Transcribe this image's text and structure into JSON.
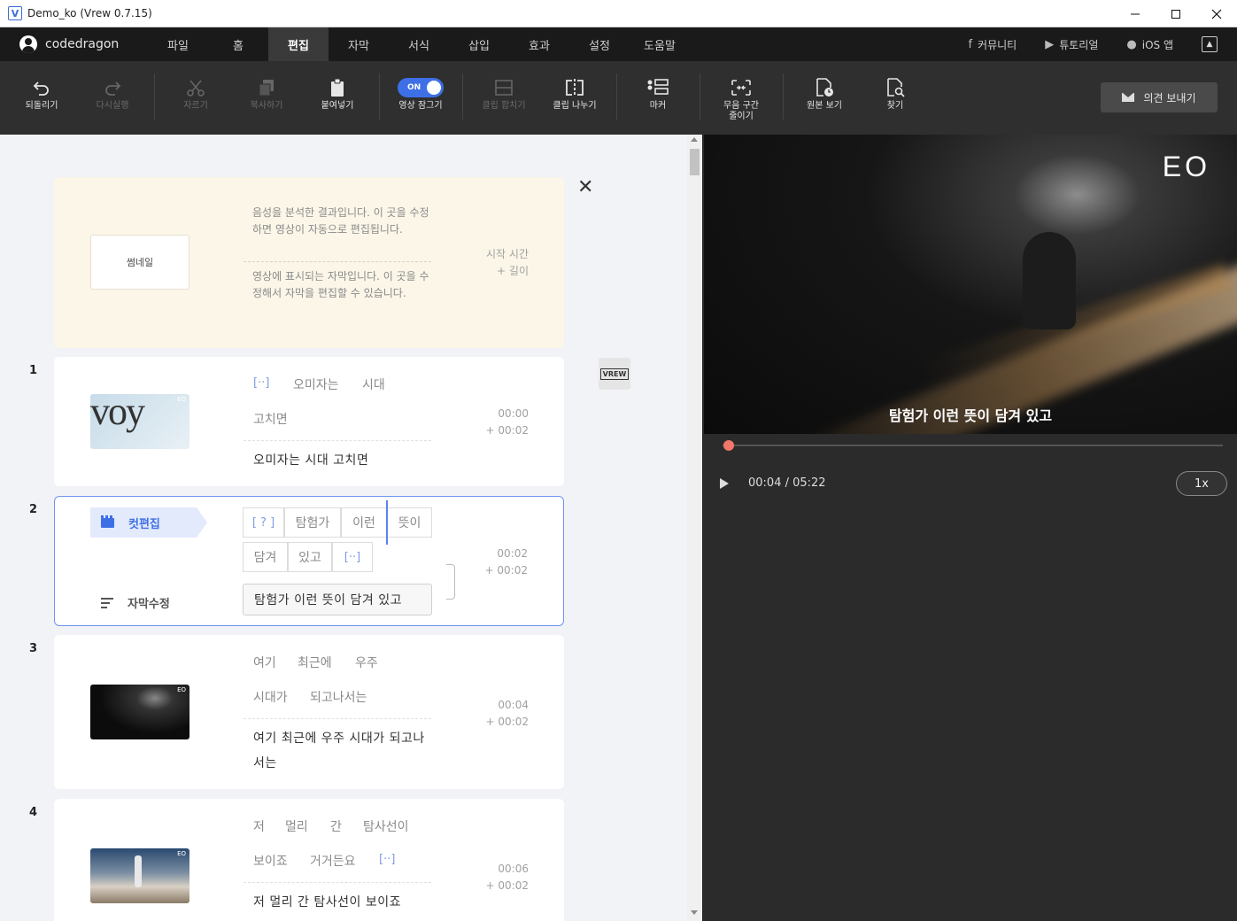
{
  "window": {
    "title": "Demo_ko (Vrew 0.7.15)",
    "icon_letter": "V",
    "controls": [
      "minimize-icon",
      "maximize-icon",
      "close-icon"
    ]
  },
  "menubar": {
    "user": "codedragon",
    "items": [
      "파일",
      "홈",
      "편집",
      "자막",
      "서식",
      "삽입",
      "효과",
      "설정",
      "도움말"
    ],
    "active": "편집",
    "links": [
      {
        "label": "커뮤니티",
        "icon": "facebook-icon"
      },
      {
        "label": "튜토리얼",
        "icon": "youtube-icon"
      },
      {
        "label": "iOS 앱",
        "icon": "apple-icon"
      }
    ]
  },
  "toolbar": {
    "undo": "되돌리기",
    "redo": "다시실행",
    "cut": "자르기",
    "copy": "복사하기",
    "paste": "붙여넣기",
    "toggle_on": "ON",
    "lock_video": "영상 잠그기",
    "merge_clip": "클립 합치기",
    "split_clip": "클립 나누기",
    "marker": "마커",
    "shrink_silence": "무음 구간\n줄이기",
    "view_original": "원본 보기",
    "find": "찾기",
    "feedback": "의견 보내기"
  },
  "guide": {
    "thumbnail": "썸네일",
    "text1": "음성을 분석한 결과입니다. 이 곳을 수정하면 영상이 자동으로 편집됩니다.",
    "text2": "영상에 표시되는 자막입니다. 이 곳을 수정해서 자막을 편집할 수 있습니다.",
    "time1": "시작 시간",
    "time2": "+ 길이"
  },
  "clips": [
    {
      "num": "1",
      "words_row1": [
        "[··]",
        "오미자는",
        "시대"
      ],
      "words_row2": [
        "고치면"
      ],
      "subtitle": "오미자는 시대 고치면",
      "start": "00:00",
      "length": "+ 00:02"
    },
    {
      "num": "2",
      "cut_edit": "컷편집",
      "sub_edit": "자막수정",
      "words_row1": [
        "[ ? ]",
        "탐험가",
        "이런",
        "뜻이"
      ],
      "words_row2": [
        "담겨",
        "있고",
        "[··]"
      ],
      "subtitle": "탐험가 이런 뜻이 담겨 있고",
      "start": "00:02",
      "length": "+ 00:02"
    },
    {
      "num": "3",
      "words_row1": [
        "여기",
        "최근에",
        "우주"
      ],
      "words_row2": [
        "시대가",
        "되고나서는"
      ],
      "subtitle": "여기 최근에 우주 시대가 되고나서는",
      "start": "00:04",
      "length": "+ 00:02"
    },
    {
      "num": "4",
      "words_row1": [
        "저",
        "멀리",
        "간",
        "탐사선이"
      ],
      "words_row2": [
        "보이죠",
        "거거든요",
        "[··]"
      ],
      "subtitle": "저 멀리 간 탐사선이 보이죠",
      "start": "00:06",
      "length": "+ 00:02"
    }
  ],
  "badge": "VREW",
  "thumb1_text": "voy",
  "thumb_logo": "EO",
  "preview": {
    "logo": "EO",
    "subtitle": "탐험가 이런 뜻이 담겨 있고",
    "time": "00:04 / 05:22",
    "speed": "1x",
    "progress": 0.012
  },
  "colors": {
    "accent": "#3d6fe6",
    "seek_knob": "#f0786a",
    "guide_bg": "#fbf6e8"
  }
}
